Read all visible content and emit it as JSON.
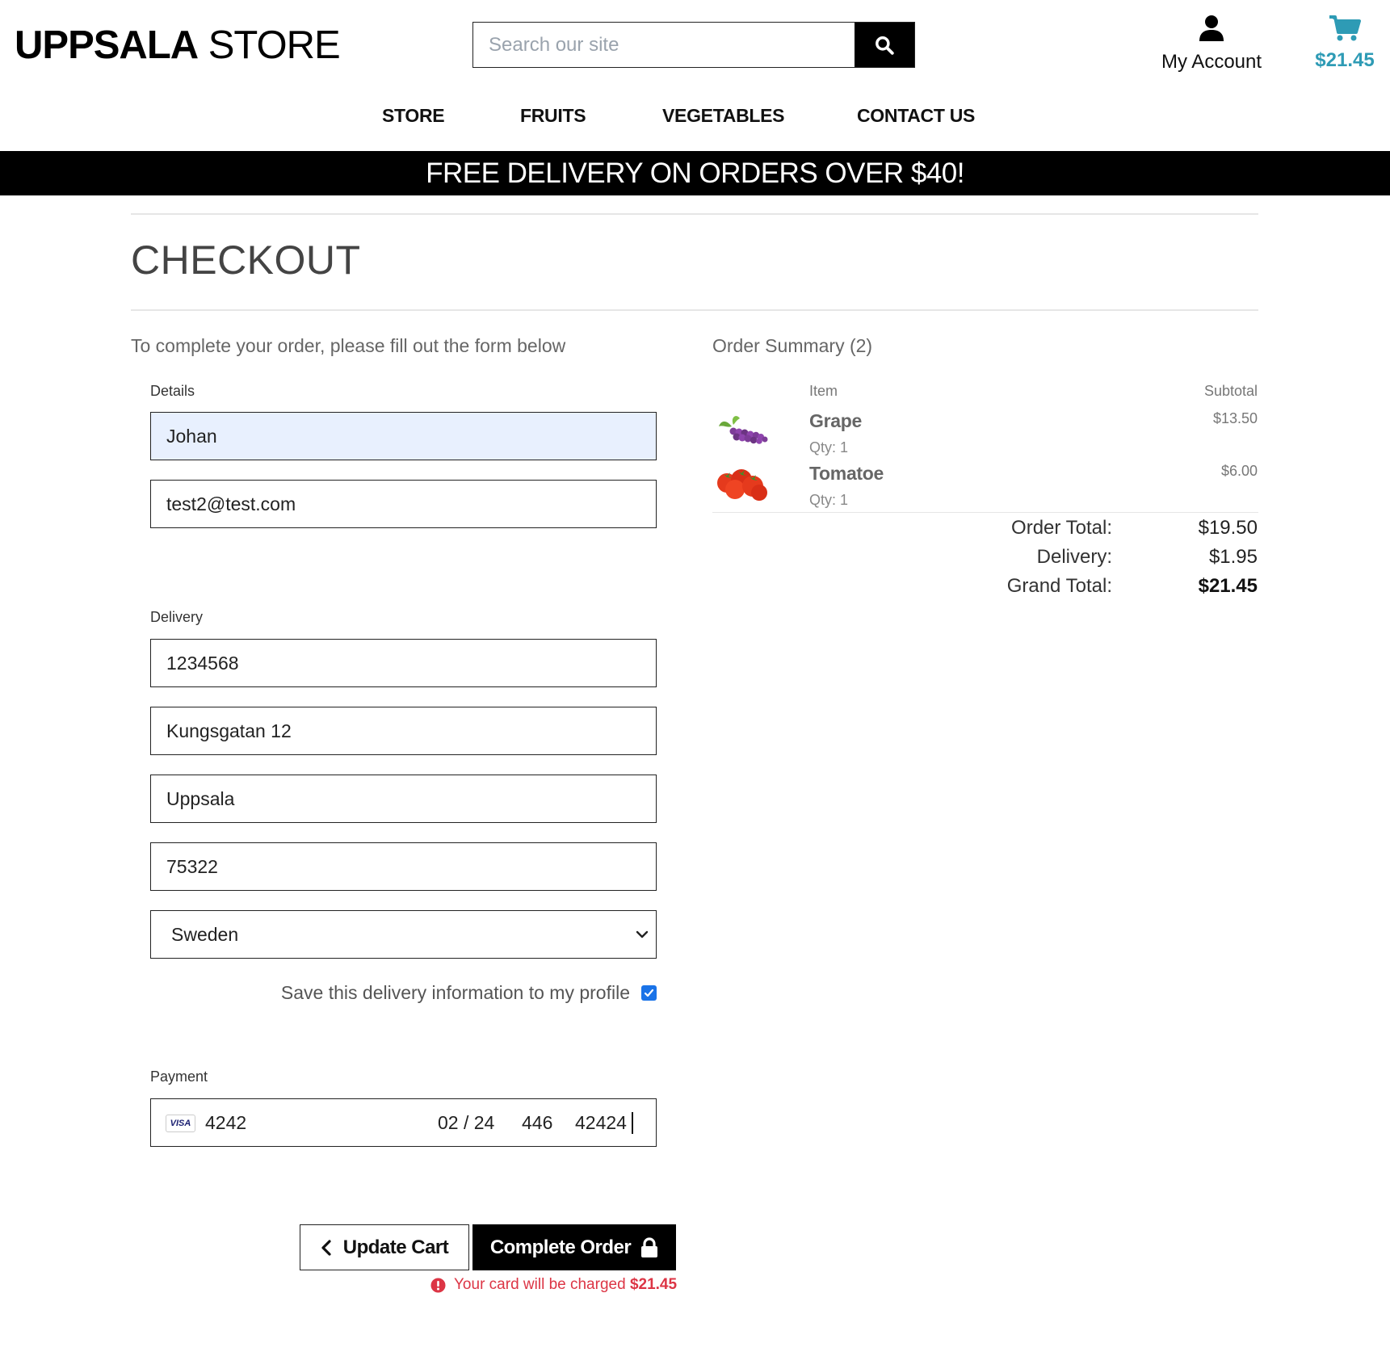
{
  "brand": {
    "part1": "UPPSALA",
    "part2": " STORE"
  },
  "search": {
    "placeholder": "Search our site"
  },
  "account": {
    "label": "My Account",
    "icon": "user-icon"
  },
  "cart": {
    "amount": "$21.45",
    "icon": "cart-icon",
    "color": "#2e9bb5"
  },
  "nav": [
    "STORE",
    "FRUITS",
    "VEGETABLES",
    "CONTACT US"
  ],
  "banner": "FREE DELIVERY ON ORDERS OVER $40!",
  "page_title": "CHECKOUT",
  "form": {
    "intro": "To complete your order, please fill out the form below",
    "details_label": "Details",
    "full_name": "Johan",
    "email": "test2@test.com",
    "delivery_label": "Delivery",
    "phone": "1234568",
    "street": "Kungsgatan 12",
    "city": "Uppsala",
    "postcode": "75322",
    "country": "Sweden",
    "save_info": "Save this delivery information to my profile",
    "payment_label": "Payment",
    "card": {
      "brand": "VISA",
      "number": "4242",
      "expiry": "02 / 24",
      "cvc": "446",
      "zip": "42424"
    }
  },
  "buttons": {
    "update_cart": "Update Cart",
    "complete_order": "Complete Order"
  },
  "charge_notice": {
    "text": "Your card will be charged",
    "amount": "$21.45",
    "color": "#dc3545"
  },
  "summary": {
    "title": "Order Summary (2)",
    "col_item": "Item",
    "col_subtotal": "Subtotal",
    "items": [
      {
        "name": "Grape",
        "qty": "Qty: 1",
        "price": "$13.50"
      },
      {
        "name": "Tomatoe",
        "qty": "Qty: 1",
        "price": "$6.00"
      }
    ],
    "order_total_label": "Order Total:",
    "order_total": "$19.50",
    "delivery_label": "Delivery:",
    "delivery": "$1.95",
    "grand_total_label": "Grand Total:",
    "grand_total": "$21.45"
  }
}
